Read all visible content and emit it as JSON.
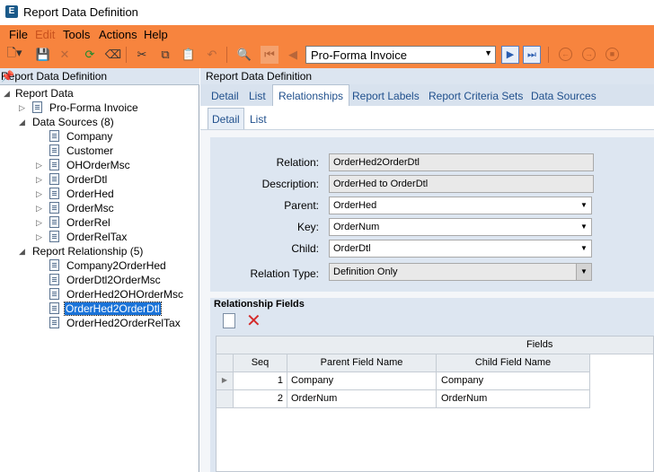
{
  "window": {
    "title": "Report Data Definition",
    "app_icon_letter": "E"
  },
  "menu": {
    "items": [
      "File",
      "Edit",
      "Tools",
      "Actions",
      "Help"
    ],
    "disabled": [
      "Edit"
    ]
  },
  "toolbar": {
    "record_value": "Pro-Forma Invoice"
  },
  "left_panel": {
    "title": "Report Data Definition",
    "tree": {
      "root": "Report Data",
      "report": "Pro-Forma Invoice",
      "data_sources_label": "Data Sources (8)",
      "data_sources": [
        "Company",
        "Customer",
        "OHOrderMsc",
        "OrderDtl",
        "OrderHed",
        "OrderMsc",
        "OrderRel",
        "OrderRelTax"
      ],
      "relationships_label": "Report Relationship (5)",
      "relationships": [
        "Company2OrderHed",
        "OrderDtl2OrderMsc",
        "OrderHed2OHOrderMsc",
        "OrderHed2OrderDtl",
        "OrderHed2OrderRelTax"
      ],
      "selected": "OrderHed2OrderDtl"
    }
  },
  "right_panel": {
    "title": "Report Data Definition",
    "tabs": [
      "Detail",
      "List",
      "Relationships",
      "Report Labels",
      "Report Criteria Sets",
      "Data Sources"
    ],
    "active_tab": "Relationships",
    "subtabs": [
      "Detail",
      "List"
    ],
    "active_subtab": "Detail",
    "form": {
      "relation_label": "Relation:",
      "relation": "OrderHed2OrderDtl",
      "description_label": "Description:",
      "description": "OrderHed to OrderDtl",
      "parent_label": "Parent:",
      "parent": "OrderHed",
      "key_label": "Key:",
      "key": "OrderNum",
      "child_label": "Child:",
      "child": "OrderDtl",
      "relation_type_label": "Relation Type:",
      "relation_type": "Definition Only"
    },
    "relationship_fields": {
      "title": "Relationship Fields",
      "group_header": "Fields",
      "columns": [
        "Seq",
        "Parent Field Name",
        "Child Field Name"
      ],
      "rows": [
        {
          "seq": "1",
          "parent": "Company",
          "child": "Company"
        },
        {
          "seq": "2",
          "parent": "OrderNum",
          "child": "OrderNum"
        }
      ]
    }
  }
}
